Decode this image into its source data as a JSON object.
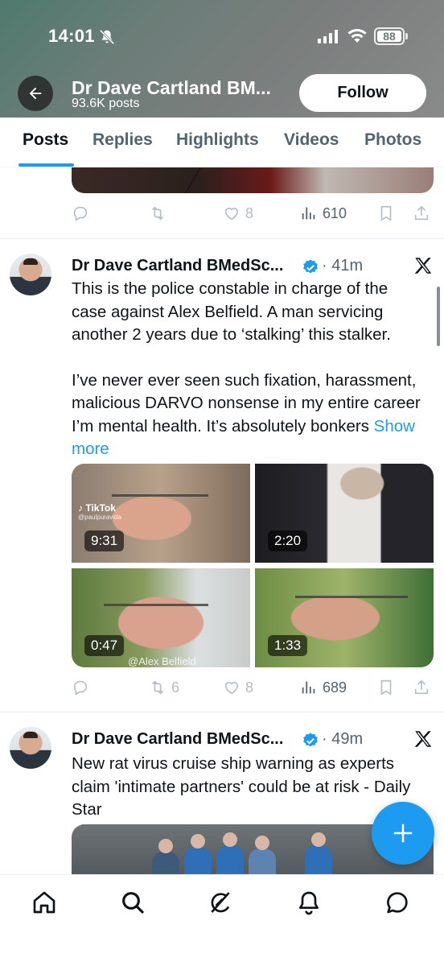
{
  "status_bar": {
    "time": "14:01",
    "battery": "88"
  },
  "header": {
    "profile_name": "Dr Dave Cartland BM...",
    "posts_count": "93.6K posts",
    "follow_label": "Follow"
  },
  "tabs": [
    {
      "label": "Posts",
      "active": true
    },
    {
      "label": "Replies",
      "active": false
    },
    {
      "label": "Highlights",
      "active": false
    },
    {
      "label": "Videos",
      "active": false
    },
    {
      "label": "Photos",
      "active": false
    }
  ],
  "tweets": [
    {
      "partial": true,
      "likes": "8",
      "views": "610"
    },
    {
      "author": "Dr Dave Cartland BMedSc...",
      "verified": true,
      "time": "41m",
      "text_p1": "This is the police constable in charge of the case against Alex Belfield. A man servicing another 2 years due to ‘stalking’ this stalker.",
      "text_p2": "I’ve never ever seen such fixation, harassment, malicious DARVO nonsense in my entire career I’m mental health. It’s absolutely bonkers",
      "show_more": "Show more",
      "videos": [
        {
          "duration": "9:31",
          "watermark": "TikTok",
          "watermark_handle": "@paulpuravida"
        },
        {
          "duration": "2:20"
        },
        {
          "duration": "0:47",
          "watermark": "@Alex Belfield"
        },
        {
          "duration": "1:33"
        }
      ],
      "retweets": "6",
      "likes": "8",
      "views": "689"
    },
    {
      "author": "Dr Dave Cartland BMedSc...",
      "verified": true,
      "time": "49m",
      "text": "New rat virus cruise ship warning as experts claim 'intimate partners' could be at risk - Daily Star"
    }
  ],
  "colors": {
    "accent": "#1d9bf0",
    "text": "#0f1419",
    "muted": "#536471"
  },
  "bottom_nav": [
    "home-icon",
    "search-icon",
    "grok-icon",
    "notifications-icon",
    "messages-icon"
  ]
}
